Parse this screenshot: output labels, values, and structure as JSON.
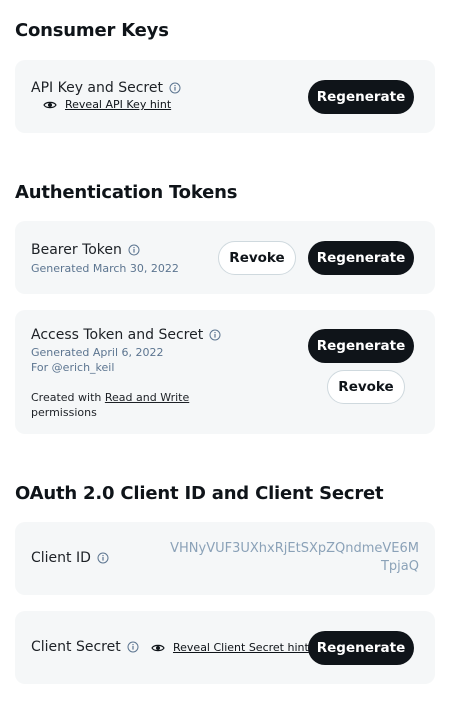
{
  "consumer_keys": {
    "title": "Consumer Keys",
    "api_key": {
      "label": "API Key and Secret",
      "hint_link": "Reveal API Key hint",
      "regenerate": "Regenerate"
    }
  },
  "auth_tokens": {
    "title": "Authentication Tokens",
    "bearer": {
      "label": "Bearer Token",
      "generated": "Generated March 30, 2022",
      "revoke": "Revoke",
      "regenerate": "Regenerate"
    },
    "access": {
      "label": "Access Token and Secret",
      "generated": "Generated April 6, 2022",
      "for_user": "For @erich_keil",
      "created_prefix": "Created with",
      "created_link": "Read and Write",
      "created_suffix": "permissions",
      "regenerate": "Regenerate",
      "revoke": "Revoke"
    }
  },
  "oauth": {
    "title": "OAuth 2.0 Client ID and Client Secret",
    "client_id": {
      "label": "Client ID",
      "value": "VHNyVUF3UXhxRjEtSXpZQndmeVE6MTpjaQ"
    },
    "client_secret": {
      "label": "Client Secret",
      "hint_link": "Reveal Client Secret hint",
      "regenerate": "Regenerate"
    }
  },
  "icons": {
    "info": "info-circle-icon",
    "eye": "eye-icon"
  },
  "colors": {
    "card_bg": "#f5f7f8",
    "primary_button": "#0f1419",
    "muted_text": "#5c7590",
    "client_id_text": "#8ba2b8"
  }
}
